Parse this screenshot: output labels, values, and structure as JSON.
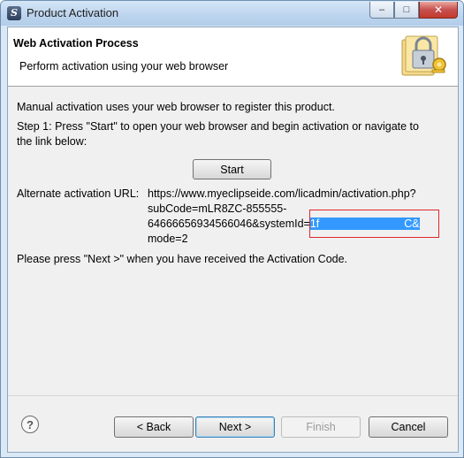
{
  "window": {
    "title": "Product Activation",
    "controls": {
      "minimize": "–",
      "maximize": "□",
      "close": "✕"
    }
  },
  "banner": {
    "title": "Web Activation Process",
    "description": "Perform activation using your web browser",
    "icon": "lock-key-icon"
  },
  "content": {
    "intro": "Manual activation uses your web browser to register this product.",
    "step1_line1": "Step 1: Press \"Start\" to open your web browser and begin activation or navigate to",
    "step1_line2": "the link below:",
    "start_button": "Start",
    "alternate_label": "Alternate activation URL:",
    "url_line1": "https://www.myeclipseide.com/licadmin/activation.php?",
    "url_line2": "subCode=mLR8ZC-855555-",
    "url_line3_prefix": "64666656934566046&systemId=",
    "url_line3_highlight": "1f",
    "url_line3_highlight_tail": "C&",
    "url_line4": "mode=2",
    "final_note": "Please press \"Next >\" when you have received the Activation Code."
  },
  "footer": {
    "help_symbol": "?",
    "back": "< Back",
    "next": "Next >",
    "finish": "Finish",
    "cancel": "Cancel"
  },
  "colors": {
    "highlight": "#3399ff",
    "redaction_box": "#e0262b",
    "default_button_border": "#3c7fb1"
  }
}
